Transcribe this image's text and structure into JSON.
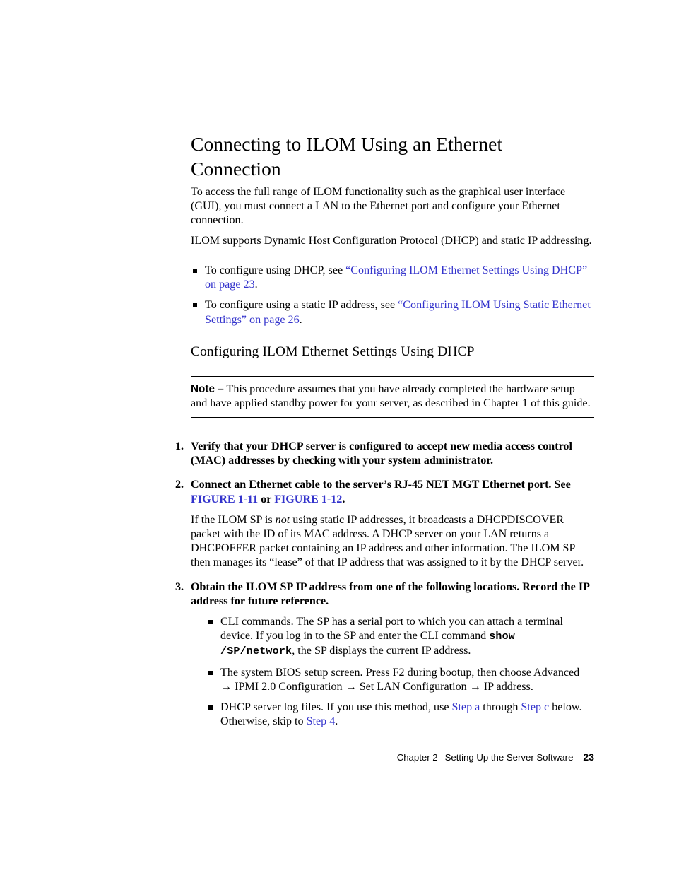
{
  "document": {
    "chapter_title": "Connecting to ILOM Using an Ethernet Connection",
    "intro_paragraph_1": "To access the full range of ILOM functionality such as the graphical user interface (GUI), you must connect a LAN to the Ethernet port and configure your Ethernet connection.",
    "intro_paragraph_2": "ILOM supports Dynamic Host Configuration Protocol (DHCP) and static IP addressing.",
    "intro_bullets": [
      {
        "prefix": "To configure using DHCP, see ",
        "link": "“Configuring ILOM Ethernet Settings Using DHCP” on page 23",
        "suffix": "."
      },
      {
        "prefix": "To configure using a static IP address, see ",
        "link": "“Configuring ILOM Using Static Ethernet Settings” on page 26",
        "suffix": "."
      }
    ],
    "section_heading": "Configuring ILOM Ethernet Settings Using DHCP",
    "note": {
      "label": "Note –",
      "text": " This procedure assumes that you have already completed the hardware setup and have applied standby power for your server, as described in Chapter 1 of this guide."
    },
    "steps": [
      {
        "number": "1.",
        "title": "Verify that your DHCP server is configured to accept new media access control (MAC) addresses by checking with your system administrator."
      },
      {
        "number": "2.",
        "title_prefix": "Connect an Ethernet cable to the server’s RJ-45 NET MGT Ethernet port. See ",
        "link_1": "FIGURE 1-11",
        "title_mid": " or ",
        "link_2": "FIGURE 1-12",
        "title_suffix": ".",
        "body_part_1": "If the ILOM SP is ",
        "body_italic": "not",
        "body_part_2": " using static IP addresses, it broadcasts a DHCPDISCOVER packet with the ID of its MAC address. A DHCP server on your LAN returns a DHCPOFFER packet containing an IP address and other information. The ILOM SP then manages its “lease” of that IP address that was assigned to it by the DHCP server."
      },
      {
        "number": "3.",
        "title": "Obtain the ILOM SP IP address from one of the following locations. Record the IP address for future reference.",
        "bullets": [
          {
            "part_1": "CLI commands. The SP has a serial port to which you can attach a terminal device. If you log in to the SP and enter the CLI command ",
            "code": "show /SP/network",
            "part_2": ", the SP displays the current IP address."
          },
          {
            "part_1": "The system BIOS setup screen. Press F2 during bootup, then choose Advanced → IPMI 2.0 Configuration → Set LAN Configuration → IP address."
          },
          {
            "part_1": "DHCP server log files. If you use this method, use ",
            "link_a": "Step a",
            "part_2": " through ",
            "link_c": "Step c",
            "part_3": " below. Otherwise, skip to ",
            "link_4": "Step 4",
            "part_4": "."
          }
        ]
      }
    ],
    "footer": {
      "chapter": "Chapter 2",
      "title": "Setting Up the Server Software",
      "page": "23"
    },
    "colors": {
      "link": "#3333cc",
      "text": "#000000",
      "background": "#ffffff"
    }
  }
}
